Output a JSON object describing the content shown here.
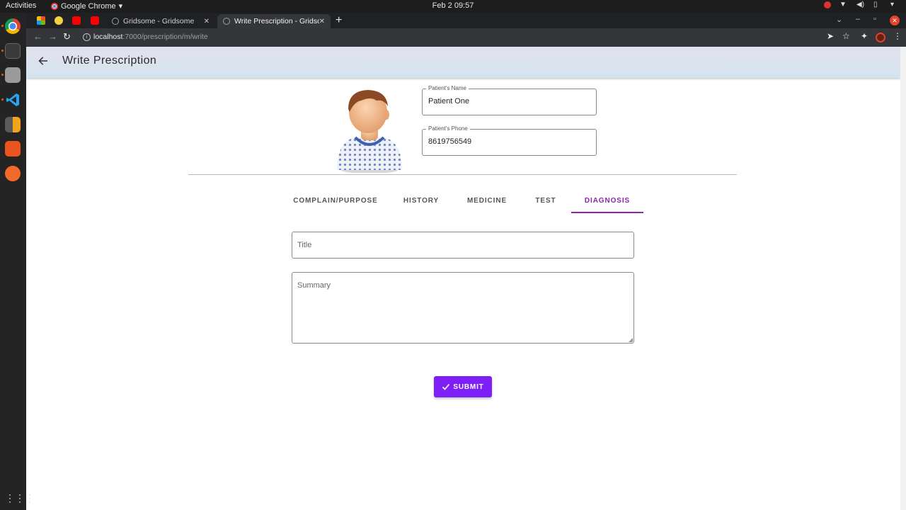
{
  "system": {
    "activities_label": "Activities",
    "app_menu_label": "Google Chrome",
    "clock": "Feb 2  09:57"
  },
  "browser": {
    "tabs": [
      {
        "title": "Gridsome - Gridsome",
        "active": false
      },
      {
        "title": "Write Prescription - Gridsome",
        "active": true
      }
    ],
    "new_tab_label": "+",
    "url_host": "localhost",
    "url_path": ":7000/prescription/m/write"
  },
  "appbar": {
    "title": "Write Prescription"
  },
  "patient": {
    "name_label": "Patient's Name",
    "name_value": "Patient One",
    "phone_label": "Patient's Phone",
    "phone_value": "8619756549"
  },
  "tabs": [
    {
      "label": "COMPLAIN/PURPOSE",
      "selected": false
    },
    {
      "label": "HISTORY",
      "selected": false
    },
    {
      "label": "MEDICINE",
      "selected": false
    },
    {
      "label": "TEST",
      "selected": false
    },
    {
      "label": "DIAGNOSIS",
      "selected": true
    }
  ],
  "diagnosis_form": {
    "title_placeholder": "Title",
    "summary_placeholder": "Summary"
  },
  "submit": {
    "label": "SUBMIT",
    "icon": "check-icon"
  },
  "colors": {
    "accent": "#8e24aa",
    "submit_bg": "#7e1ff7",
    "appbar_start": "#e3e1ef",
    "appbar_end": "#d3e4ee"
  }
}
